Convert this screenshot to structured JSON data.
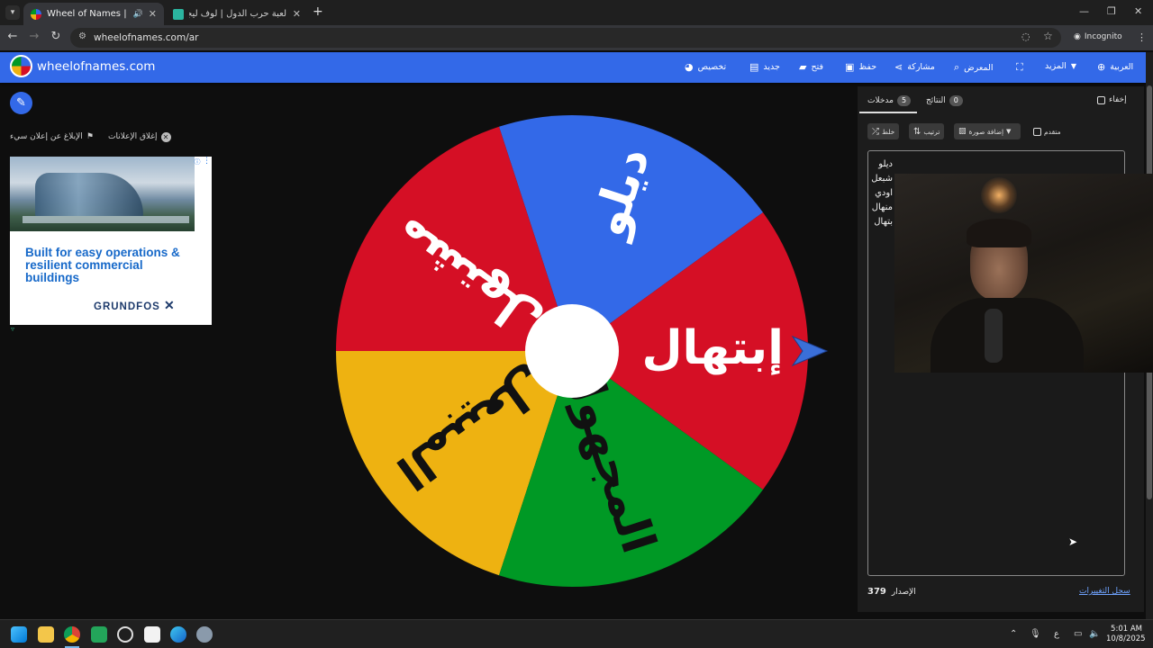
{
  "browser": {
    "tabs": [
      {
        "title": "Wheel of Names | العشوائي",
        "active": true
      },
      {
        "title": "لعبة حرب الدول | لوف ليجو يوفر",
        "active": false
      }
    ],
    "new_tab": "+",
    "url": "wheelofnames.com/ar",
    "incognito_label": "Incognito"
  },
  "site": {
    "title": "wheelofnames.com",
    "menu": {
      "customize": "تخصيص",
      "new": "جديد",
      "open": "فتح",
      "save": "حفظ",
      "share": "مشاركة",
      "gallery": "المعرض",
      "more": "المزيد",
      "language": "العربية"
    }
  },
  "left": {
    "close_ads": "إغلاق الإعلانات",
    "report_ad": "الإبلاغ عن إعلان سيء",
    "ad": {
      "headline": "Built for easy operations & resilient commercial buildings",
      "brand": "GRUNDFOS"
    }
  },
  "wheel": {
    "slices": [
      {
        "label": "ديلو",
        "color": "#3369e8"
      },
      {
        "label": "مشتهل",
        "color": "#d50f25"
      },
      {
        "label": "المبيعل",
        "color": "#eeb211"
      },
      {
        "label": "المجهول",
        "color": "#009925"
      },
      {
        "label": "إبتهال",
        "color": "#d50f25"
      }
    ]
  },
  "panel": {
    "hide_label": "إخفاء",
    "tab_entries": "مدخلات",
    "entries_count": "5",
    "tab_results": "النتائج",
    "results_count": "0",
    "shuffle": "خلط",
    "sort": "ترتيب",
    "add_image": "إضافة صورة",
    "advanced": "متقدم",
    "entries": [
      "ديلو",
      "شبعل",
      "اودي",
      "منهال",
      "بتهال"
    ],
    "version_label": "الإصدار",
    "version": "379",
    "changelog": "سجل التغييرات"
  },
  "taskbar": {
    "time": "5:01 AM",
    "date": "10/8/2025",
    "lang": "ع"
  }
}
